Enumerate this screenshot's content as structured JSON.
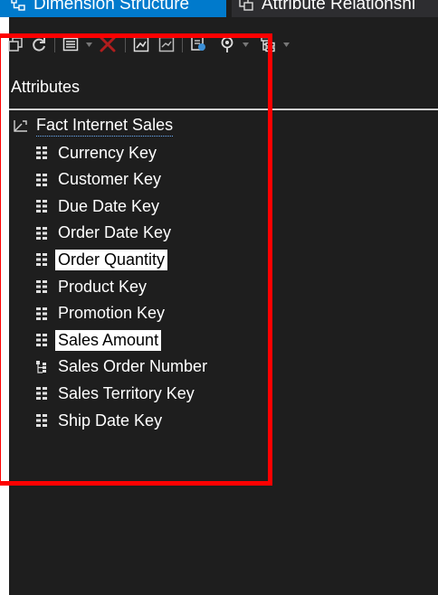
{
  "tabs": [
    {
      "label": "Dimension Structure",
      "active": true,
      "icon": "dimension-structure-icon"
    },
    {
      "label": "Attribute Relationshi",
      "active": false,
      "icon": "attribute-relationships-icon"
    }
  ],
  "toolbar": {
    "buttons": [
      "process-icon",
      "refresh-icon",
      "properties-icon",
      "delete-icon",
      "show-table-icon",
      "hide-table-icon",
      "new-named-query-icon",
      "zoom-icon",
      "show-attribute-tree-icon"
    ]
  },
  "attributes_panel": {
    "header": "Attributes",
    "root": {
      "label": "Fact Internet Sales",
      "icon": "dimension-icon"
    },
    "items": [
      {
        "label": "Currency Key",
        "icon": "attribute-icon",
        "selected": false
      },
      {
        "label": "Customer Key",
        "icon": "attribute-icon",
        "selected": false
      },
      {
        "label": "Due Date Key",
        "icon": "attribute-icon",
        "selected": false
      },
      {
        "label": "Order Date Key",
        "icon": "attribute-icon",
        "selected": false
      },
      {
        "label": "Order Quantity",
        "icon": "attribute-icon",
        "selected": true
      },
      {
        "label": "Product Key",
        "icon": "attribute-icon",
        "selected": false
      },
      {
        "label": "Promotion Key",
        "icon": "attribute-icon",
        "selected": false
      },
      {
        "label": "Sales Amount",
        "icon": "attribute-icon",
        "selected": true
      },
      {
        "label": "Sales Order Number",
        "icon": "key-attribute-icon",
        "selected": false
      },
      {
        "label": "Sales Territory Key",
        "icon": "attribute-icon",
        "selected": false
      },
      {
        "label": "Ship Date Key",
        "icon": "attribute-icon",
        "selected": false
      }
    ]
  },
  "colors": {
    "pane_background": "#1e1e1e",
    "active_tab": "#007acc",
    "selection_background": "#ffffff",
    "annotation_border": "#ff0000"
  }
}
